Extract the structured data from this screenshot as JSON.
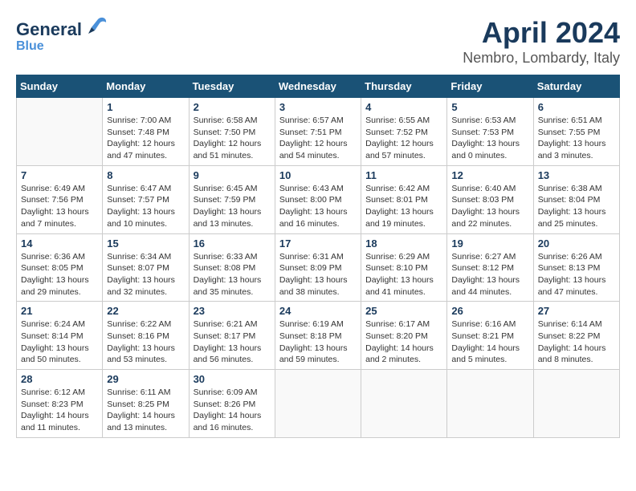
{
  "logo": {
    "name": "General",
    "name2": "Blue"
  },
  "title": "April 2024",
  "subtitle": "Nembro, Lombardy, Italy",
  "columns": [
    "Sunday",
    "Monday",
    "Tuesday",
    "Wednesday",
    "Thursday",
    "Friday",
    "Saturday"
  ],
  "weeks": [
    [
      {
        "num": "",
        "sunrise": "",
        "sunset": "",
        "daylight": ""
      },
      {
        "num": "1",
        "sunrise": "Sunrise: 7:00 AM",
        "sunset": "Sunset: 7:48 PM",
        "daylight": "Daylight: 12 hours and 47 minutes."
      },
      {
        "num": "2",
        "sunrise": "Sunrise: 6:58 AM",
        "sunset": "Sunset: 7:50 PM",
        "daylight": "Daylight: 12 hours and 51 minutes."
      },
      {
        "num": "3",
        "sunrise": "Sunrise: 6:57 AM",
        "sunset": "Sunset: 7:51 PM",
        "daylight": "Daylight: 12 hours and 54 minutes."
      },
      {
        "num": "4",
        "sunrise": "Sunrise: 6:55 AM",
        "sunset": "Sunset: 7:52 PM",
        "daylight": "Daylight: 12 hours and 57 minutes."
      },
      {
        "num": "5",
        "sunrise": "Sunrise: 6:53 AM",
        "sunset": "Sunset: 7:53 PM",
        "daylight": "Daylight: 13 hours and 0 minutes."
      },
      {
        "num": "6",
        "sunrise": "Sunrise: 6:51 AM",
        "sunset": "Sunset: 7:55 PM",
        "daylight": "Daylight: 13 hours and 3 minutes."
      }
    ],
    [
      {
        "num": "7",
        "sunrise": "Sunrise: 6:49 AM",
        "sunset": "Sunset: 7:56 PM",
        "daylight": "Daylight: 13 hours and 7 minutes."
      },
      {
        "num": "8",
        "sunrise": "Sunrise: 6:47 AM",
        "sunset": "Sunset: 7:57 PM",
        "daylight": "Daylight: 13 hours and 10 minutes."
      },
      {
        "num": "9",
        "sunrise": "Sunrise: 6:45 AM",
        "sunset": "Sunset: 7:59 PM",
        "daylight": "Daylight: 13 hours and 13 minutes."
      },
      {
        "num": "10",
        "sunrise": "Sunrise: 6:43 AM",
        "sunset": "Sunset: 8:00 PM",
        "daylight": "Daylight: 13 hours and 16 minutes."
      },
      {
        "num": "11",
        "sunrise": "Sunrise: 6:42 AM",
        "sunset": "Sunset: 8:01 PM",
        "daylight": "Daylight: 13 hours and 19 minutes."
      },
      {
        "num": "12",
        "sunrise": "Sunrise: 6:40 AM",
        "sunset": "Sunset: 8:03 PM",
        "daylight": "Daylight: 13 hours and 22 minutes."
      },
      {
        "num": "13",
        "sunrise": "Sunrise: 6:38 AM",
        "sunset": "Sunset: 8:04 PM",
        "daylight": "Daylight: 13 hours and 25 minutes."
      }
    ],
    [
      {
        "num": "14",
        "sunrise": "Sunrise: 6:36 AM",
        "sunset": "Sunset: 8:05 PM",
        "daylight": "Daylight: 13 hours and 29 minutes."
      },
      {
        "num": "15",
        "sunrise": "Sunrise: 6:34 AM",
        "sunset": "Sunset: 8:07 PM",
        "daylight": "Daylight: 13 hours and 32 minutes."
      },
      {
        "num": "16",
        "sunrise": "Sunrise: 6:33 AM",
        "sunset": "Sunset: 8:08 PM",
        "daylight": "Daylight: 13 hours and 35 minutes."
      },
      {
        "num": "17",
        "sunrise": "Sunrise: 6:31 AM",
        "sunset": "Sunset: 8:09 PM",
        "daylight": "Daylight: 13 hours and 38 minutes."
      },
      {
        "num": "18",
        "sunrise": "Sunrise: 6:29 AM",
        "sunset": "Sunset: 8:10 PM",
        "daylight": "Daylight: 13 hours and 41 minutes."
      },
      {
        "num": "19",
        "sunrise": "Sunrise: 6:27 AM",
        "sunset": "Sunset: 8:12 PM",
        "daylight": "Daylight: 13 hours and 44 minutes."
      },
      {
        "num": "20",
        "sunrise": "Sunrise: 6:26 AM",
        "sunset": "Sunset: 8:13 PM",
        "daylight": "Daylight: 13 hours and 47 minutes."
      }
    ],
    [
      {
        "num": "21",
        "sunrise": "Sunrise: 6:24 AM",
        "sunset": "Sunset: 8:14 PM",
        "daylight": "Daylight: 13 hours and 50 minutes."
      },
      {
        "num": "22",
        "sunrise": "Sunrise: 6:22 AM",
        "sunset": "Sunset: 8:16 PM",
        "daylight": "Daylight: 13 hours and 53 minutes."
      },
      {
        "num": "23",
        "sunrise": "Sunrise: 6:21 AM",
        "sunset": "Sunset: 8:17 PM",
        "daylight": "Daylight: 13 hours and 56 minutes."
      },
      {
        "num": "24",
        "sunrise": "Sunrise: 6:19 AM",
        "sunset": "Sunset: 8:18 PM",
        "daylight": "Daylight: 13 hours and 59 minutes."
      },
      {
        "num": "25",
        "sunrise": "Sunrise: 6:17 AM",
        "sunset": "Sunset: 8:20 PM",
        "daylight": "Daylight: 14 hours and 2 minutes."
      },
      {
        "num": "26",
        "sunrise": "Sunrise: 6:16 AM",
        "sunset": "Sunset: 8:21 PM",
        "daylight": "Daylight: 14 hours and 5 minutes."
      },
      {
        "num": "27",
        "sunrise": "Sunrise: 6:14 AM",
        "sunset": "Sunset: 8:22 PM",
        "daylight": "Daylight: 14 hours and 8 minutes."
      }
    ],
    [
      {
        "num": "28",
        "sunrise": "Sunrise: 6:12 AM",
        "sunset": "Sunset: 8:23 PM",
        "daylight": "Daylight: 14 hours and 11 minutes."
      },
      {
        "num": "29",
        "sunrise": "Sunrise: 6:11 AM",
        "sunset": "Sunset: 8:25 PM",
        "daylight": "Daylight: 14 hours and 13 minutes."
      },
      {
        "num": "30",
        "sunrise": "Sunrise: 6:09 AM",
        "sunset": "Sunset: 8:26 PM",
        "daylight": "Daylight: 14 hours and 16 minutes."
      },
      {
        "num": "",
        "sunrise": "",
        "sunset": "",
        "daylight": ""
      },
      {
        "num": "",
        "sunrise": "",
        "sunset": "",
        "daylight": ""
      },
      {
        "num": "",
        "sunrise": "",
        "sunset": "",
        "daylight": ""
      },
      {
        "num": "",
        "sunrise": "",
        "sunset": "",
        "daylight": ""
      }
    ]
  ]
}
